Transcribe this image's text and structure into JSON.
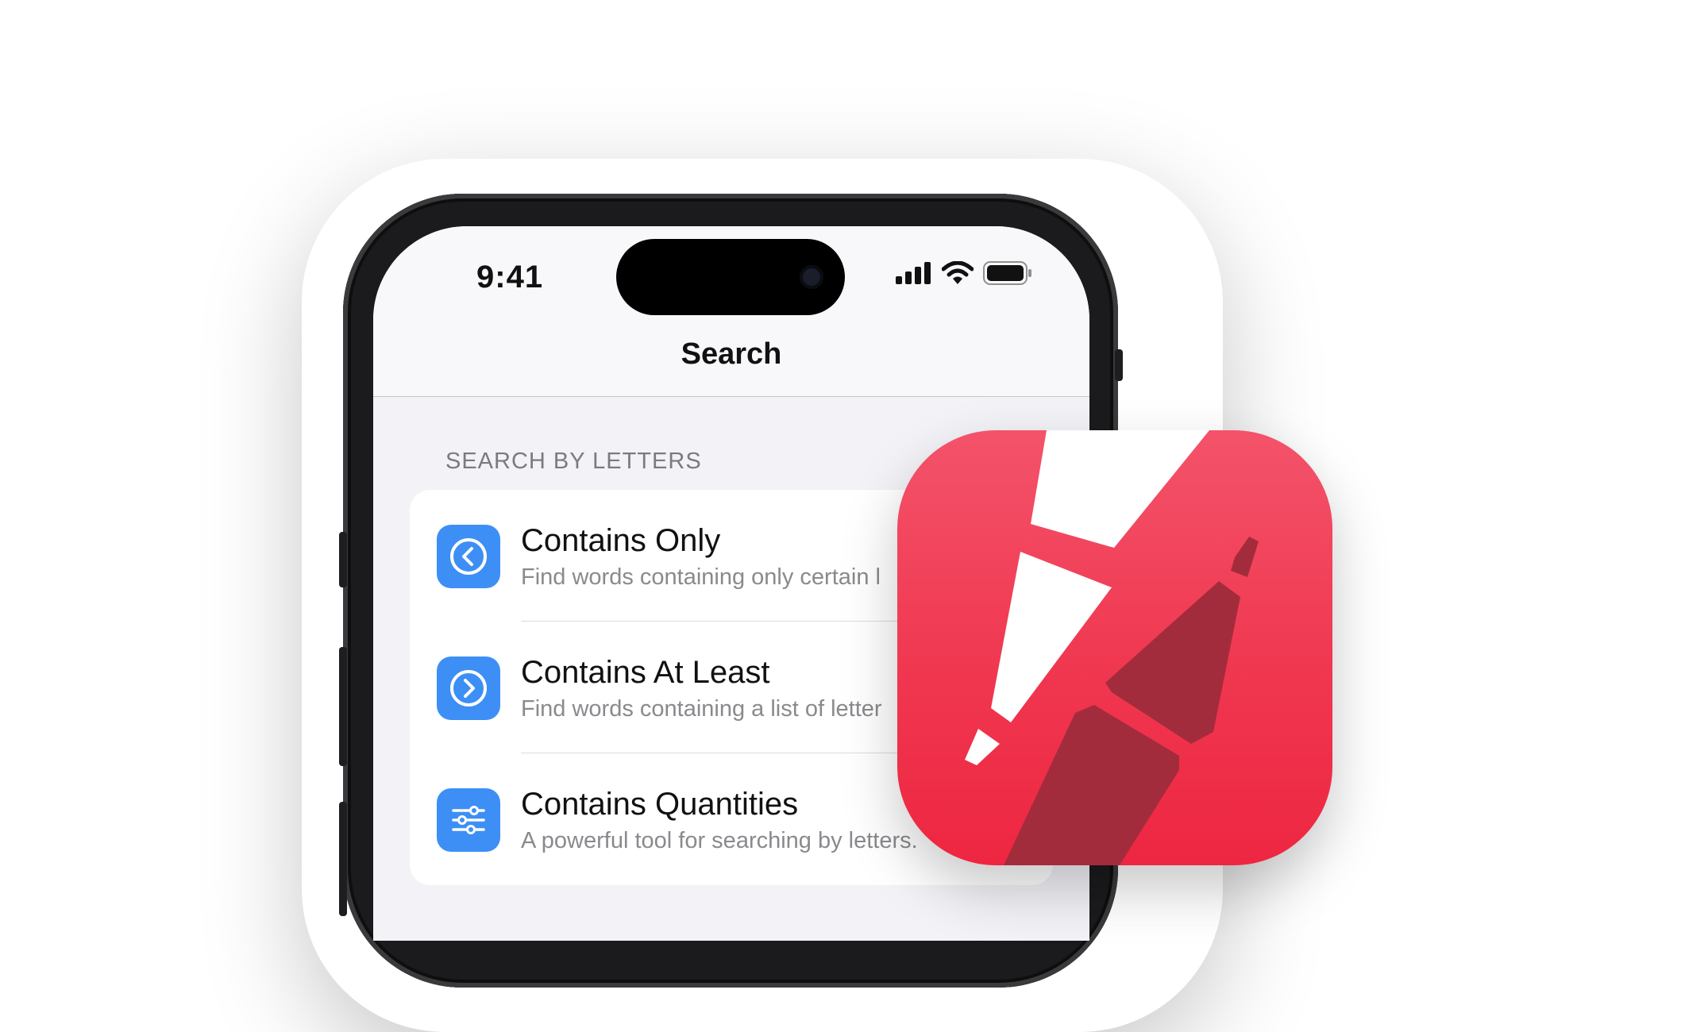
{
  "status_bar": {
    "time": "9:41"
  },
  "nav": {
    "title": "Search"
  },
  "section": {
    "header": "SEARCH BY LETTERS"
  },
  "rows": [
    {
      "icon": "chevron-left-circle-icon",
      "title": "Contains Only",
      "subtitle": "Find words containing only certain l"
    },
    {
      "icon": "chevron-right-circle-icon",
      "title": "Contains At Least",
      "subtitle": "Find words containing a list of letter"
    },
    {
      "icon": "sliders-icon",
      "title": "Contains Quantities",
      "subtitle": "A powerful tool for searching by letters."
    }
  ],
  "colors": {
    "accent_blue": "#3d8ff5",
    "app_icon_red": "#f03750",
    "app_icon_dark": "#a32c3c"
  }
}
